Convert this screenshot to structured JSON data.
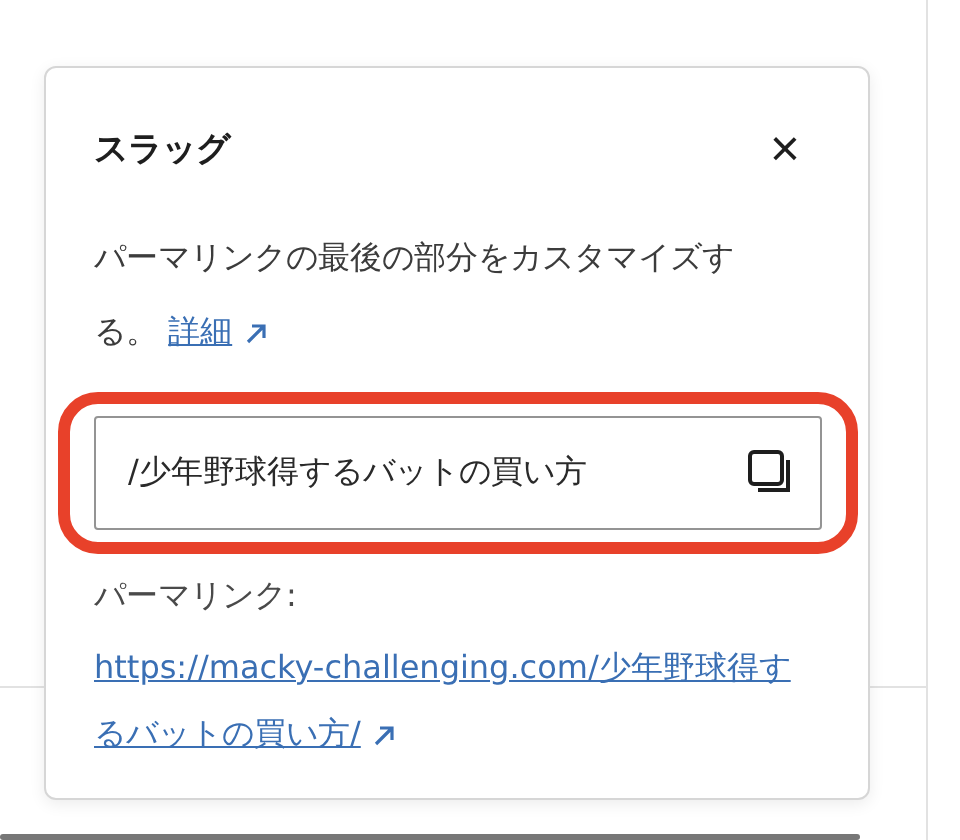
{
  "popover": {
    "title": "スラッグ",
    "close_label": "×",
    "description": "パーマリンクの最後の部分をカスタマイズする。",
    "learn_more_link": "詳細",
    "slug_field": {
      "value": "/少年野球得するバットの買い方",
      "highlighted": true
    },
    "permalink_label": "パーマリンク:",
    "permalink_url": "https://macky-challenging.com/少年野球得するバットの買い方/"
  }
}
